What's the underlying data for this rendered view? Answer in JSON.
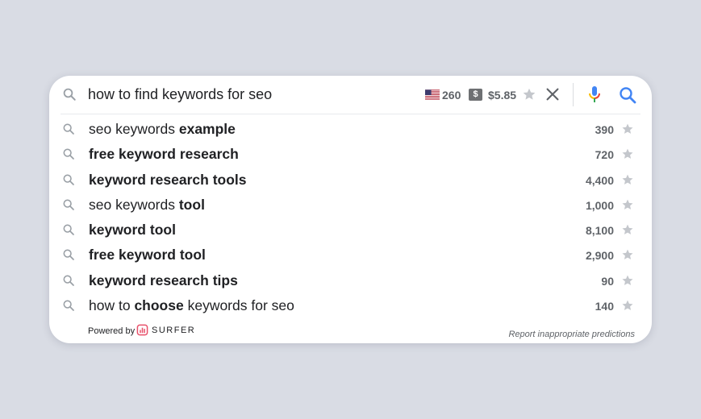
{
  "search": {
    "query": "how to find keywords for seo",
    "country_flag": "us-flag-icon",
    "volume": "260",
    "cpc_icon_label": "$",
    "cpc": "$5.85"
  },
  "suggestions": [
    {
      "parts": [
        {
          "text": "seo keywords ",
          "bold": false
        },
        {
          "text": "example",
          "bold": true
        }
      ],
      "volume": "390"
    },
    {
      "parts": [
        {
          "text": "free keyword research",
          "bold": true
        }
      ],
      "volume": "720"
    },
    {
      "parts": [
        {
          "text": "keyword research tools",
          "bold": true
        }
      ],
      "volume": "4,400"
    },
    {
      "parts": [
        {
          "text": "seo keywords ",
          "bold": false
        },
        {
          "text": "tool",
          "bold": true
        }
      ],
      "volume": "1,000"
    },
    {
      "parts": [
        {
          "text": "keyword tool",
          "bold": true
        }
      ],
      "volume": "8,100"
    },
    {
      "parts": [
        {
          "text": "free keyword tool",
          "bold": true
        }
      ],
      "volume": "2,900"
    },
    {
      "parts": [
        {
          "text": "keyword research tips",
          "bold": true
        }
      ],
      "volume": "90"
    },
    {
      "parts": [
        {
          "text": "how to ",
          "bold": false
        },
        {
          "text": "choose",
          "bold": true
        },
        {
          "text": " keywords for seo",
          "bold": false
        }
      ],
      "volume": "140"
    }
  ],
  "footer": {
    "powered_by": "Powered by",
    "brand": "SURFER",
    "report": "Report inappropriate predictions"
  },
  "colors": {
    "background": "#d9dce4",
    "card": "#ffffff",
    "mic_blue": "#4285f4",
    "mic_red": "#ea4335",
    "mic_yellow": "#fbbc05",
    "mic_green": "#34a853",
    "search_blue": "#4285f4",
    "surfer_logo": "#e8506a"
  }
}
